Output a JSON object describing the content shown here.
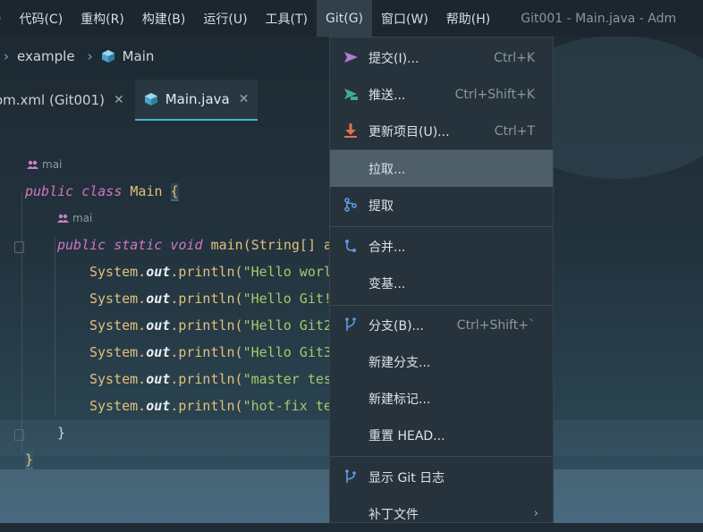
{
  "menubar": {
    "items": [
      {
        "label": ")"
      },
      {
        "label": "代码(C)"
      },
      {
        "label": "重构(R)"
      },
      {
        "label": "构建(B)"
      },
      {
        "label": "运行(U)"
      },
      {
        "label": "工具(T)"
      },
      {
        "label": "Git(G)"
      },
      {
        "label": "窗口(W)"
      },
      {
        "label": "帮助(H)"
      }
    ],
    "window_title": "Git001 - Main.java - Adm"
  },
  "navbar": {
    "breadcrumb": [
      "example",
      "Main"
    ]
  },
  "tabs": [
    {
      "label": "om.xml (Git001)",
      "close": "✕"
    },
    {
      "label": "Main.java",
      "close": "✕"
    }
  ],
  "editor": {
    "author_hint_1": "mai",
    "author_hint_2": "mai",
    "lines": [
      {
        "kw": "public class ",
        "name": "Main ",
        "brace": "{"
      },
      {
        "kw": "public static void ",
        "name": "main(String[] a"
      },
      {
        "pre": "System.",
        "field": "out",
        "post": ".println(",
        "str": "\"Hello worl"
      },
      {
        "pre": "System.",
        "field": "out",
        "post": ".println(",
        "str": "\"Hello Git!"
      },
      {
        "pre": "System.",
        "field": "out",
        "post": ".println(",
        "str": "\"Hello Git2"
      },
      {
        "pre": "System.",
        "field": "out",
        "post": ".println(",
        "str": "\"Hello Git3"
      },
      {
        "pre": "System.",
        "field": "out",
        "post": ".println(",
        "str": "\"master tes"
      },
      {
        "pre": "System.",
        "field": "out",
        "post": ".println(",
        "str": "\"hot-fix te"
      },
      {
        "text": "}"
      },
      {
        "text": "}"
      }
    ]
  },
  "git_menu": {
    "items": [
      {
        "label": "提交(I)...",
        "shortcut": "Ctrl+K",
        "icon": "commit-arrow-icon"
      },
      {
        "label": "推送...",
        "shortcut": "Ctrl+Shift+K",
        "icon": "push-icon"
      },
      {
        "label": "更新项目(U)...",
        "shortcut": "Ctrl+T",
        "icon": "update-download-icon"
      },
      {
        "label": "拉取...",
        "shortcut": "",
        "icon": ""
      },
      {
        "label": "提取",
        "shortcut": "",
        "icon": "fetch-branch-icon"
      },
      {
        "label": "合并...",
        "shortcut": "",
        "icon": "merge-icon"
      },
      {
        "label": "变基...",
        "shortcut": "",
        "icon": ""
      },
      {
        "label": "分支(B)...",
        "shortcut": "Ctrl+Shift+`",
        "icon": "branch-icon"
      },
      {
        "label": "新建分支...",
        "shortcut": "",
        "icon": ""
      },
      {
        "label": "新建标记...",
        "shortcut": "",
        "icon": ""
      },
      {
        "label": "重置 HEAD...",
        "shortcut": "",
        "icon": ""
      },
      {
        "label": "显示 Git 日志",
        "shortcut": "",
        "icon": "git-log-icon"
      },
      {
        "label": "补丁文件",
        "shortcut": "",
        "icon": "",
        "submenu": "›"
      }
    ]
  },
  "colors": {
    "accent_tab": "#3fb8c5",
    "keyword": "#d276c2",
    "type": "#e3c07b",
    "string": "#a6c86a",
    "selected_menu": "#4e5f6a"
  }
}
